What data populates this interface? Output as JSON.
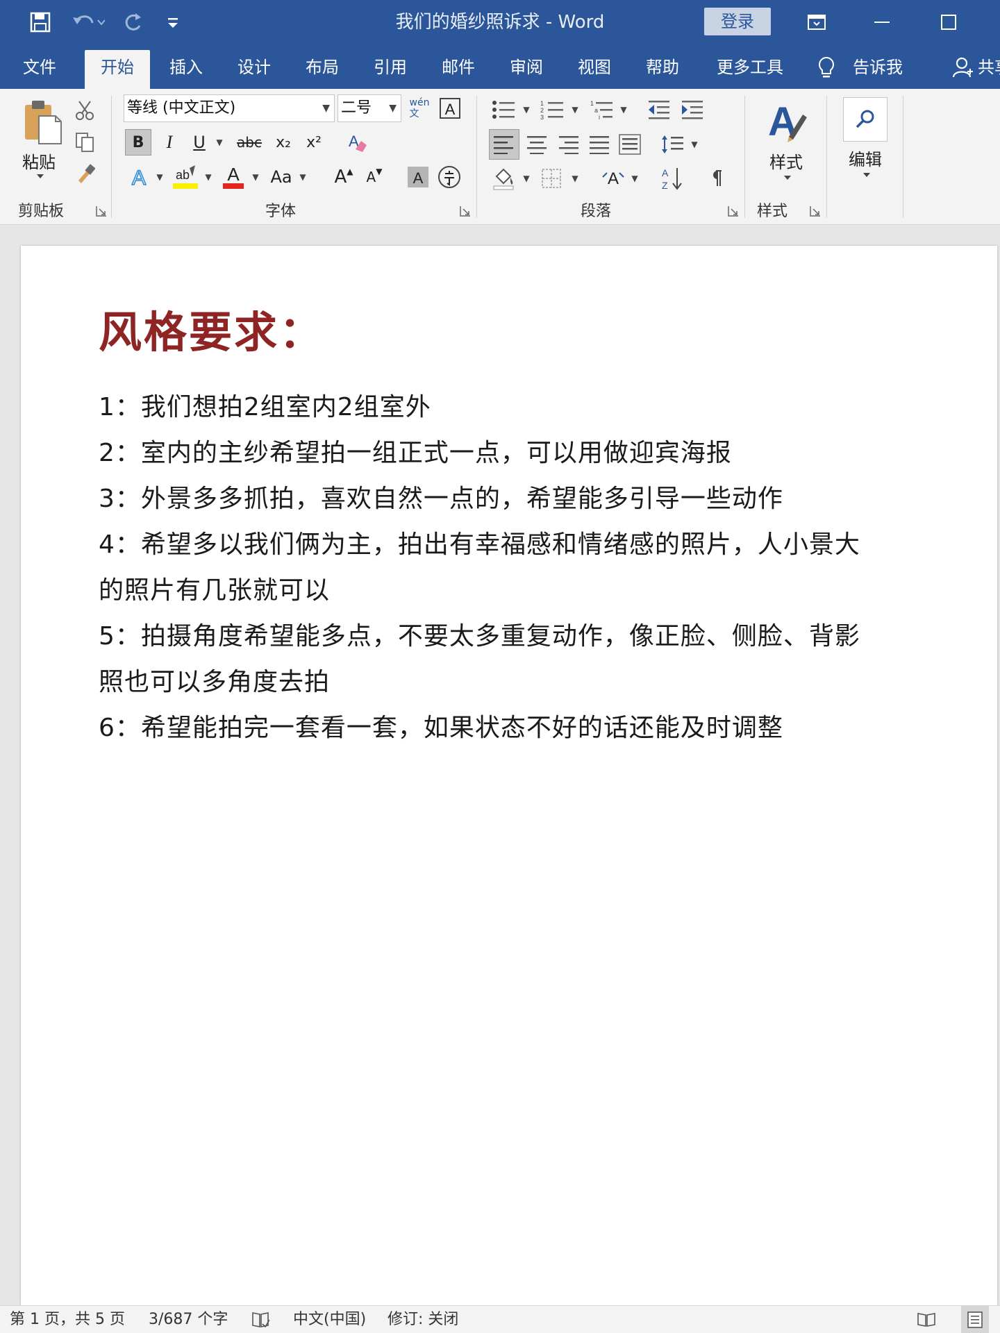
{
  "window": {
    "title": "我们的婚纱照诉求 - Word",
    "login_label": "登录"
  },
  "tabs": [
    "文件",
    "开始",
    "插入",
    "设计",
    "布局",
    "引用",
    "邮件",
    "审阅",
    "视图",
    "帮助",
    "更多工具",
    "告诉我",
    "共享"
  ],
  "active_tab": "开始",
  "ribbon": {
    "clipboard": {
      "paste_label": "粘贴",
      "group_label": "剪贴板"
    },
    "font": {
      "font_name": "等线 (中文正文)",
      "font_size": "二号",
      "bold": "B",
      "italic": "I",
      "underline": "U",
      "strike": "abc",
      "sub": "x₂",
      "sup": "x²",
      "grow": "A",
      "shrink": "A",
      "case": "Aa",
      "group_label": "字体"
    },
    "paragraph": {
      "group_label": "段落"
    },
    "styles": {
      "button_label": "样式",
      "group_label": "样式"
    },
    "editing": {
      "button_label": "编辑"
    }
  },
  "document": {
    "heading": "风格要求：",
    "lines": [
      "1：我们想拍2组室内2组室外",
      "2：室内的主纱希望拍一组正式一点，可以用做迎宾海报",
      "3：外景多多抓拍，喜欢自然一点的，希望能多引导一些动作",
      "4：希望多以我们俩为主，拍出有幸福感和情绪感的照片，人小景大",
      "的照片有几张就可以",
      "5：拍摄角度希望能多点，不要太多重复动作，像正脸、侧脸、背影",
      "照也可以多角度去拍",
      "6：希望能拍完一套看一套，如果状态不好的话还能及时调整"
    ]
  },
  "status": {
    "page": "第 1 页，共 5 页",
    "words": "3/687 个字",
    "language": "中文(中国)",
    "track": "修订: 关闭"
  },
  "colors": {
    "titlebar": "#2b579a",
    "heading": "#8e2424",
    "ribbon_bg": "#f3f3f3"
  }
}
